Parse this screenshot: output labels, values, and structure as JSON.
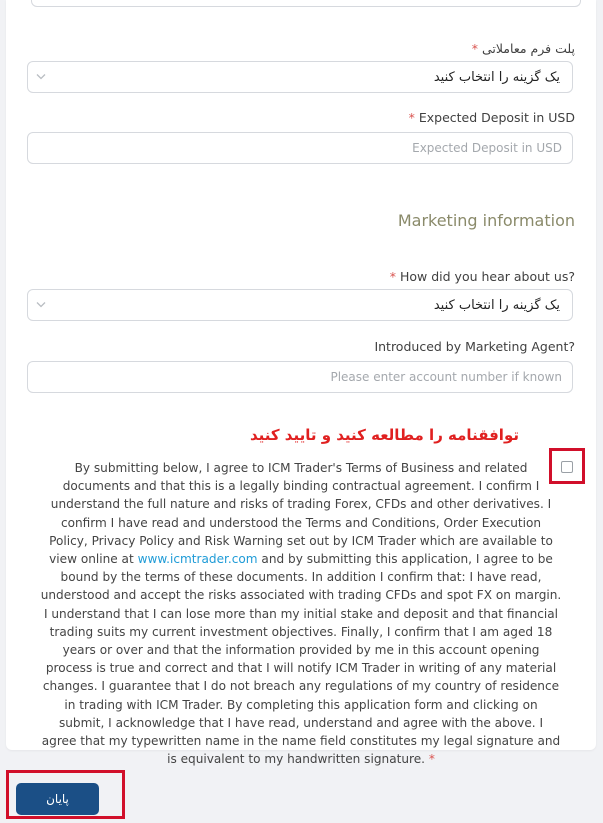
{
  "form": {
    "platform": {
      "label": "پلت فرم معاملاتی",
      "required_mark": "*",
      "selected": "یک گزینه را انتخاب کنید"
    },
    "deposit": {
      "label": "Expected Deposit in USD",
      "required_mark": "*",
      "placeholder": "Expected Deposit in USD"
    },
    "marketing_section_title": "Marketing information",
    "hear_about": {
      "label": "How did you hear about us?",
      "required_mark": "*",
      "selected": "یک گزینه را انتخاب کنید"
    },
    "agent": {
      "label": "Introduced by Marketing Agent?",
      "placeholder": "Please enter account number if known"
    }
  },
  "agreement": {
    "heading": "توافقنامه را مطالعه کنید و تایید کنید",
    "text_part1": "By submitting below, I agree to ICM Trader's Terms of Business and related documents and that this is a legally binding contractual agreement. I confirm I understand the full nature and risks of trading Forex, CFDs and other derivatives. I confirm I have read and understood the Terms and Conditions, Order Execution Policy, Privacy Policy and Risk Warning set out by ICM Trader which are available to view online at",
    "link_text": "www.icmtrader.com",
    "text_part2": "and by submitting this application, I agree to be bound by the terms of these documents. In addition I confirm that: I have read, understood and accept the risks associated with trading CFDs and spot FX on margin. I understand that I can lose more than my initial stake and deposit and that financial trading suits my current investment objectives. Finally, I confirm that I am aged 18 years or over and that the information provided by me in this account opening process is true and correct and that I will notify ICM Trader in writing of any material changes. I guarantee that I do not breach any regulations of my country of residence in trading with ICM Trader. By completing this application form and clicking on submit, I acknowledge that I have read, understand and agree with the above. I agree that my typewritten name in the name field constitutes my legal signature and is equivalent to my handwritten signature.",
    "required_mark": "*"
  },
  "submit_label": "پایان",
  "colors": {
    "required": "#d9534f",
    "highlight": "#d10f2a",
    "button": "#1b4f86",
    "link": "#1e9bd7",
    "heading_red": "#e02020"
  }
}
